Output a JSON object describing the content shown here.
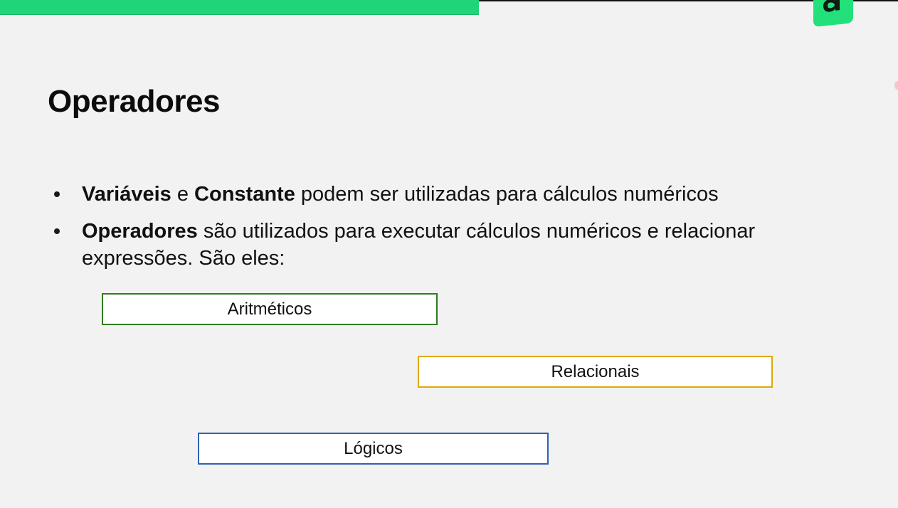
{
  "progress": {
    "fraction": 0.533,
    "color": "#1fd47b"
  },
  "logo": {
    "icon": "a-letter-logo-icon",
    "color": "#22e07a"
  },
  "slide": {
    "title": "Operadores",
    "bullets": [
      {
        "bold1": "Variáveis",
        "text1": " e ",
        "bold2": "Constante",
        "text2": " podem ser utilizadas para cálculos numéricos"
      },
      {
        "bold1": "Operadores",
        "text1": " são utilizados para executar cálculos numéricos e relacionar expressões. São eles:"
      }
    ],
    "operator_types": [
      {
        "label": "Aritméticos",
        "color": "#2e7d1f"
      },
      {
        "label": "Relacionais",
        "color": "#e0a800"
      },
      {
        "label": "Lógicos",
        "color": "#2d62b3"
      }
    ]
  }
}
